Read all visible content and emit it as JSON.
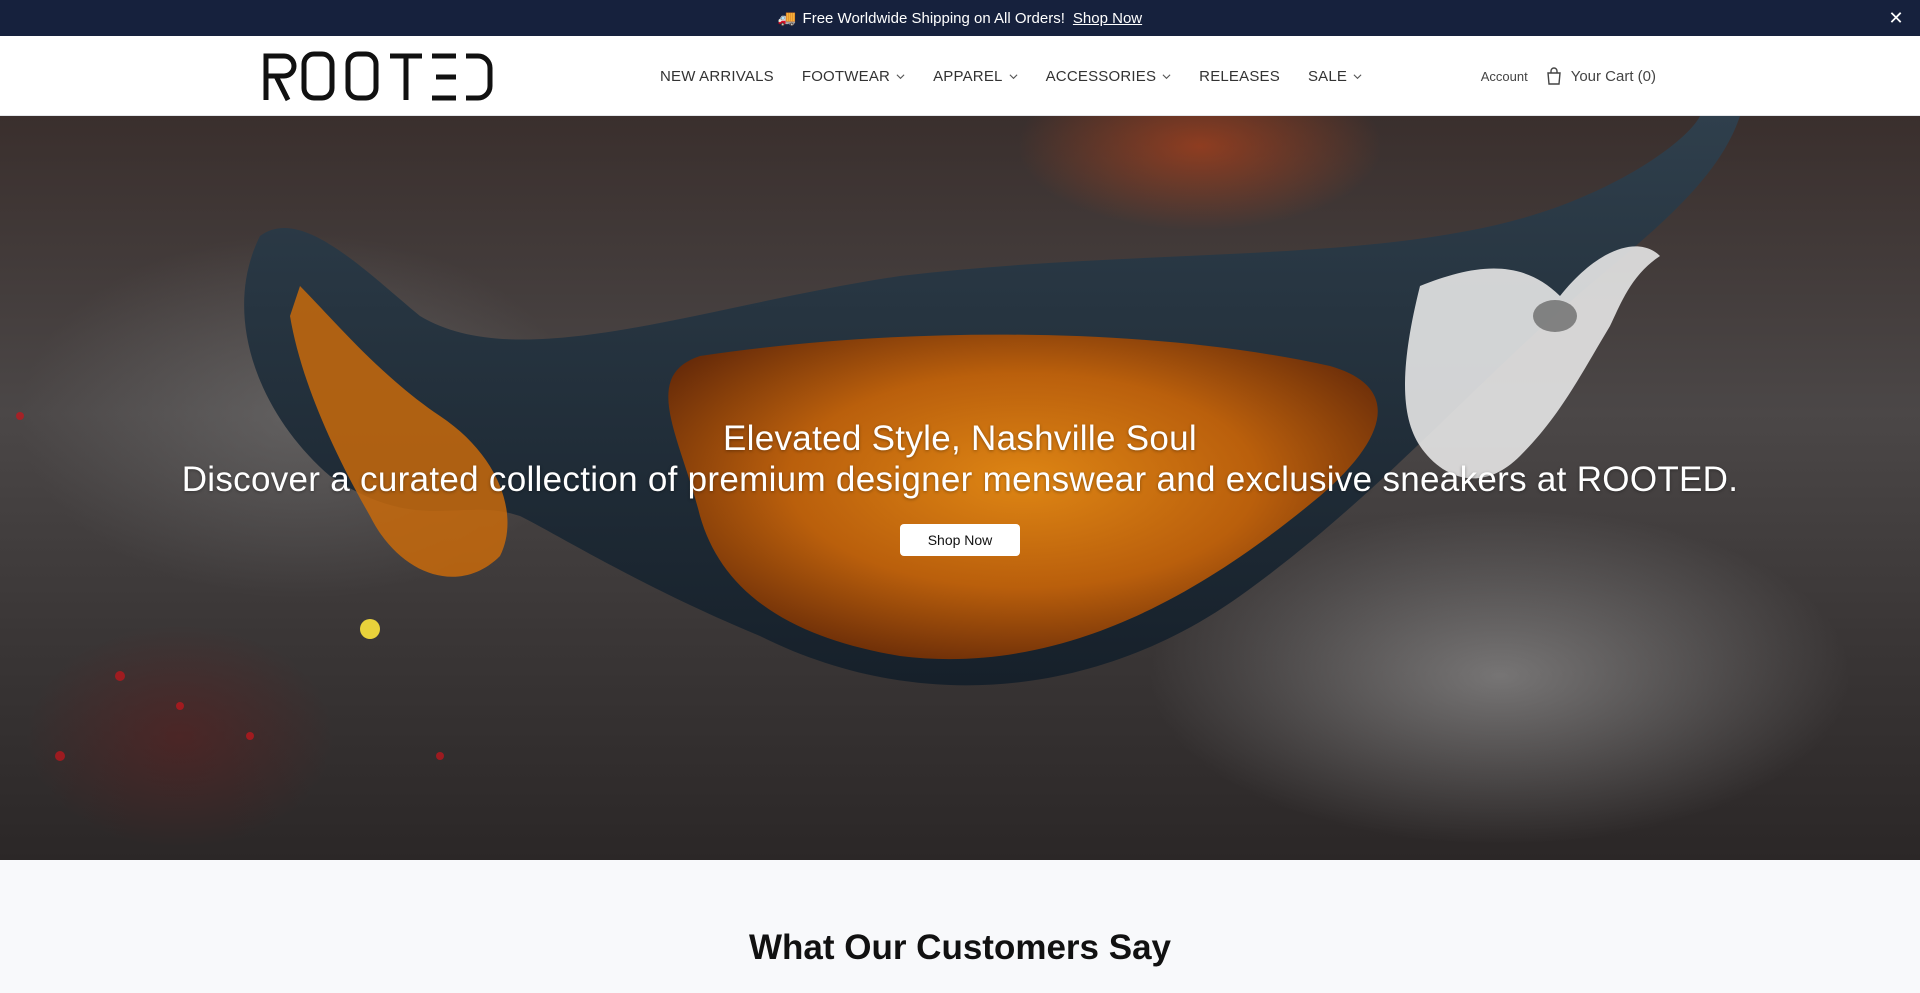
{
  "announcement": {
    "icon": "truck-icon",
    "text": "Free Worldwide Shipping on All Orders!",
    "link_label": "Shop Now",
    "close_glyph": "✕"
  },
  "header": {
    "logo_text": "ROOTED",
    "nav": [
      {
        "label": "NEW ARRIVALS",
        "has_dropdown": false
      },
      {
        "label": "FOOTWEAR",
        "has_dropdown": true
      },
      {
        "label": "APPAREL",
        "has_dropdown": true
      },
      {
        "label": "ACCESSORIES",
        "has_dropdown": true
      },
      {
        "label": "RELEASES",
        "has_dropdown": false
      },
      {
        "label": "SALE",
        "has_dropdown": true
      }
    ],
    "account_label": "Account",
    "cart_label": "Your Cart (0)"
  },
  "hero": {
    "title": "Elevated Style, Nashville Soul",
    "subtitle": "Discover a curated collection of premium designer menswear and exclusive sneakers at ROOTED.",
    "button_label": "Shop Now"
  },
  "testimonials": {
    "heading": "What Our Customers Say"
  },
  "colors": {
    "announcement_bg": "#16213d",
    "header_bg": "#ffffff",
    "page_bg": "#f8f9fb"
  }
}
